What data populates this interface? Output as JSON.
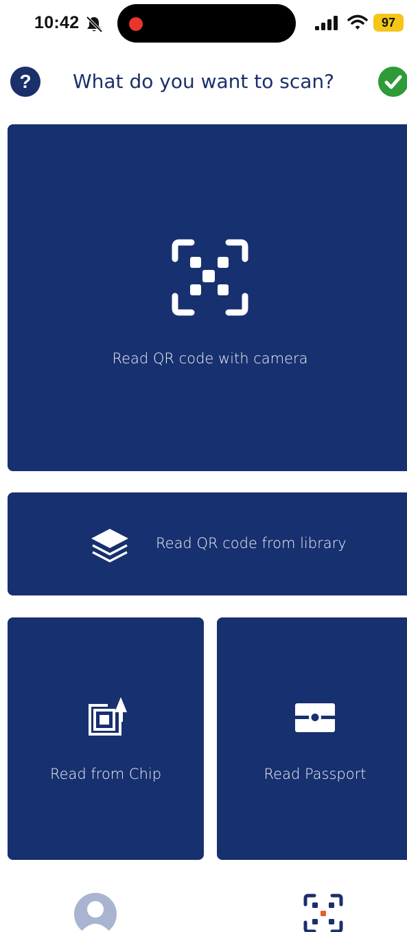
{
  "status_bar": {
    "time": "10:42",
    "battery": "97",
    "icons": [
      "bell-slash-icon",
      "signal-icon",
      "wifi-icon",
      "battery-icon"
    ],
    "battery_color": "#f5c518",
    "recording_color": "#e8362a"
  },
  "header": {
    "title": "What do you want to scan?",
    "help_label": "?",
    "help_icon": "question-icon",
    "done_icon": "checkmark-icon",
    "done_color": "#2e9a38"
  },
  "options": {
    "camera": {
      "label": "Read QR code with camera",
      "icon": "qr-scan-icon"
    },
    "library": {
      "label": "Read QR code from library",
      "icon": "layers-icon"
    },
    "chip": {
      "label": "Read from Chip",
      "icon": "chip-icon"
    },
    "passport": {
      "label": "Read Passport",
      "icon": "passport-icon"
    }
  },
  "tab_bar": {
    "items": [
      {
        "icon": "profile-icon"
      },
      {
        "icon": "scan-icon"
      }
    ]
  },
  "colors": {
    "card_background": "#17306f",
    "title": "#1b2f6b",
    "accent": "#e0622a"
  }
}
